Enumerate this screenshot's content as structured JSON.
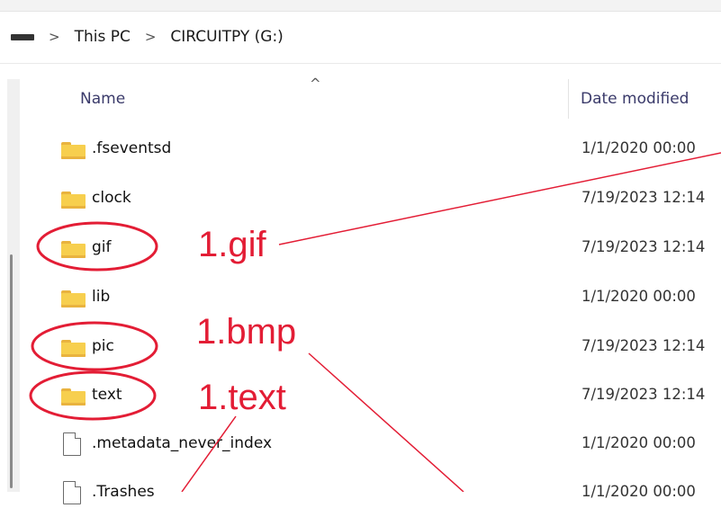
{
  "breadcrumb": {
    "drive_icon": "drive-icon",
    "separator": ">",
    "items": [
      "This PC",
      "CIRCUITPY (G:)"
    ]
  },
  "columns": {
    "name": "Name",
    "date": "Date modified",
    "sort_indicator": "^"
  },
  "files": [
    {
      "name": ".fseventsd",
      "date": "1/1/2020 00:00",
      "type": "folder"
    },
    {
      "name": "clock",
      "date": "7/19/2023 12:14",
      "type": "folder"
    },
    {
      "name": "gif",
      "date": "7/19/2023 12:14",
      "type": "folder"
    },
    {
      "name": "lib",
      "date": "1/1/2020 00:00",
      "type": "folder"
    },
    {
      "name": "pic",
      "date": "7/19/2023 12:14",
      "type": "folder"
    },
    {
      "name": "text",
      "date": "7/19/2023 12:14",
      "type": "folder"
    },
    {
      "name": ".metadata_never_index",
      "date": "1/1/2020 00:00",
      "type": "file"
    },
    {
      "name": ".Trashes",
      "date": "1/1/2020 00:00",
      "type": "file"
    }
  ],
  "annotations": {
    "gif": "1.gif",
    "bmp": "1.bmp",
    "text": "1.text",
    "color": "#e31d35"
  }
}
